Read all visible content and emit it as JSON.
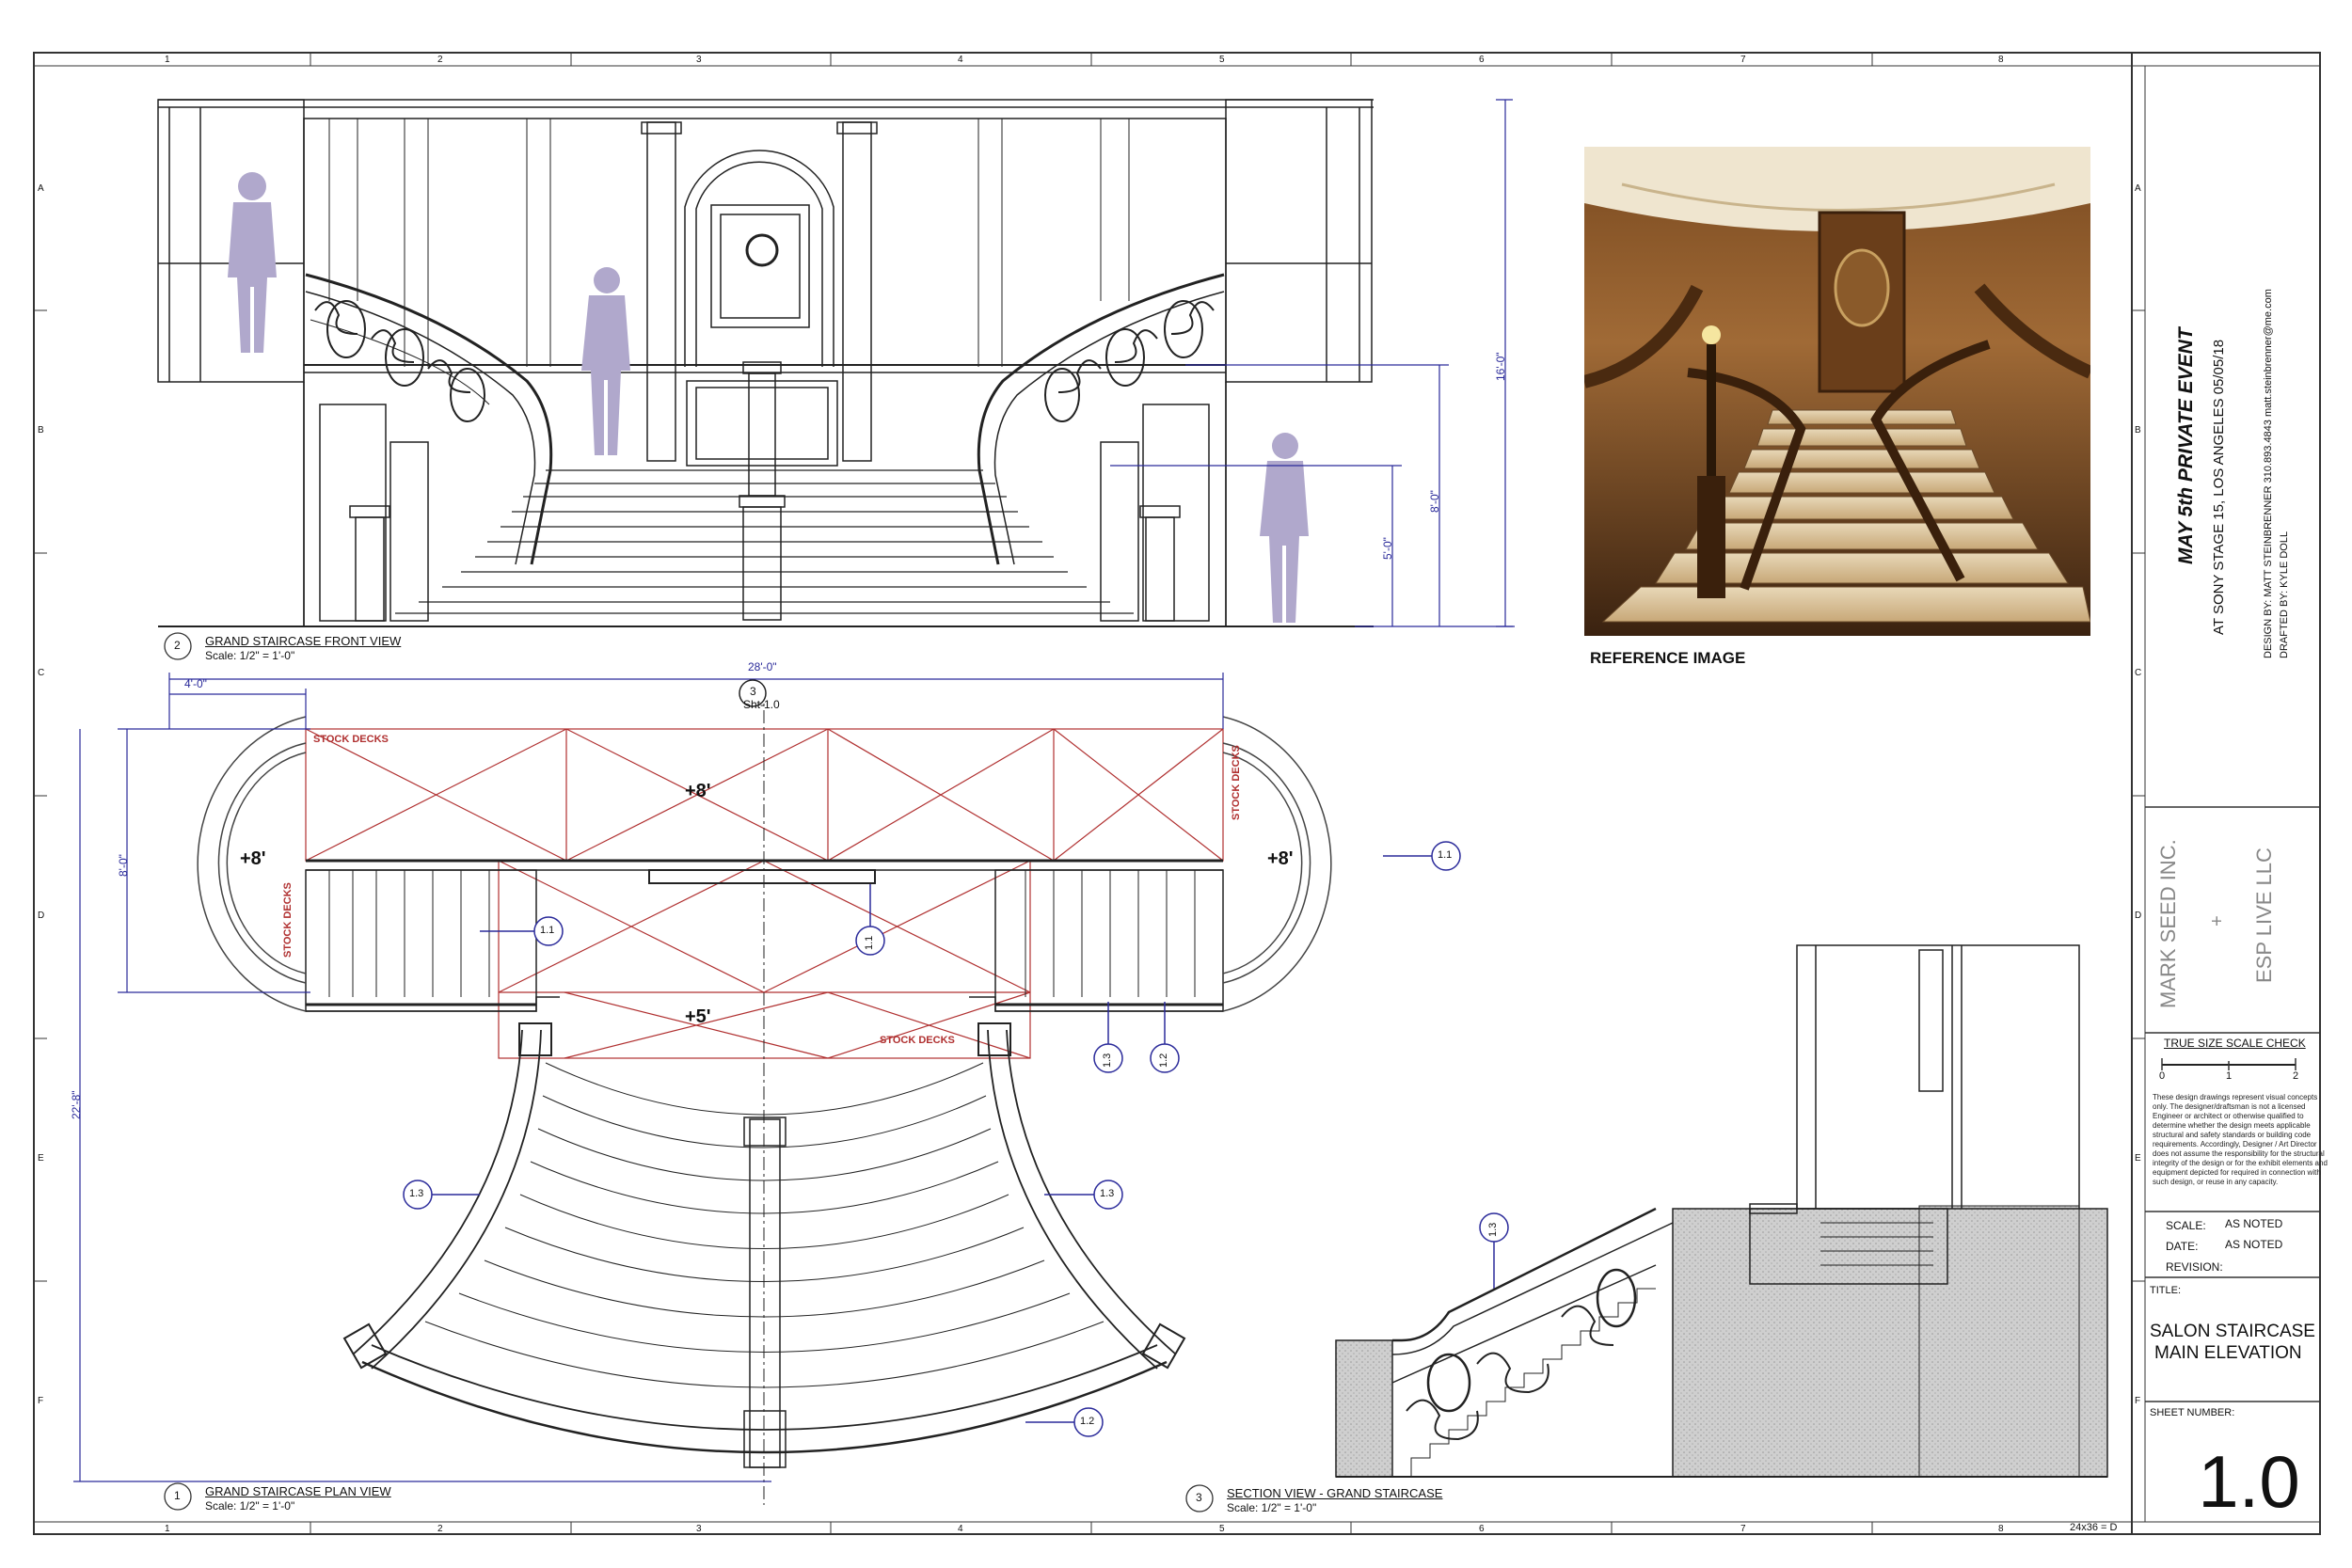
{
  "border": {
    "columns": [
      "1",
      "2",
      "3",
      "4",
      "5",
      "6",
      "7",
      "8"
    ],
    "rows": [
      "A",
      "B",
      "C",
      "D",
      "E",
      "F"
    ],
    "sheet_size": "24x36 = D"
  },
  "views": {
    "front": {
      "number": "2",
      "title": "GRAND STAIRCASE FRONT VIEW",
      "scale": "Scale: 1/2\" = 1'-0\""
    },
    "plan": {
      "number": "1",
      "title": "GRAND STAIRCASE PLAN VIEW",
      "scale": "Scale: 1/2\" = 1'-0\""
    },
    "section": {
      "number": "3",
      "title": "SECTION VIEW - GRAND STAIRCASE",
      "scale": "Scale: 1/2\" = 1'-0\""
    },
    "reference": {
      "title": "REFERENCE IMAGE"
    }
  },
  "dimensions": {
    "height_16": "16'-0\"",
    "height_8": "8'-0\"",
    "height_5": "5'-0\"",
    "width_28": "28'-0\"",
    "width_4": "4'-0\"",
    "depth_8": "8'-0\"",
    "depth_22": "22'-8\""
  },
  "plan_labels": {
    "stock_decks": "STOCK DECKS",
    "elev_main": "+8'",
    "elev_left": "+8'",
    "elev_right": "+8'",
    "elev_landing": "+5'",
    "section_ref_num": "3",
    "section_ref_sheet": "Sht-1.0"
  },
  "callouts": {
    "c11": "1.1",
    "c12": "1.2",
    "c13": "1.3"
  },
  "title_block": {
    "event_title": "MAY 5th PRIVATE EVENT",
    "event_sub": "AT SONY STAGE 15, LOS ANGELES   05/05/18",
    "design_by": "DESIGN BY:    MATT STEINBRENNER     310.893.4843     matt.steinbrenner@me.com",
    "drafted_by": "DRAFTED BY: KYLE DOLL",
    "company1": "MARK SEED INC.",
    "plus": "+",
    "company2": "ESP LIVE LLC",
    "scale_check": "TRUE SIZE SCALE CHECK",
    "scale_ticks": [
      "0",
      "1",
      "2"
    ],
    "disclaimer": "These design drawings represent visual concepts only. The designer/draftsman is not a licensed Engineer or architect or otherwise qualified to determine whether the design meets applicable structural and safety standards or building code requirements. Accordingly, Designer / Art Director does not assume the responsibility for the structural integrity of the design or for the exhibit elements and equipment depicted for required in connection with such design, or reuse in any capacity.",
    "scale_label": "SCALE:",
    "scale_value": "AS NOTED",
    "date_label": "DATE:",
    "date_value": "AS NOTED",
    "revision_label": "REVISION:",
    "title_label": "TITLE:",
    "title_line1": "SALON STAIRCASE",
    "title_line2": "MAIN ELEVATION",
    "sheet_label": "SHEET NUMBER:",
    "sheet_number": "1.0"
  },
  "colors": {
    "line": "#222222",
    "dim": "#2a2a9a",
    "red": "#b03030",
    "figure": "#b0a8cc",
    "hatch": "#c8c8c8",
    "wood": "#8a5a2b"
  }
}
